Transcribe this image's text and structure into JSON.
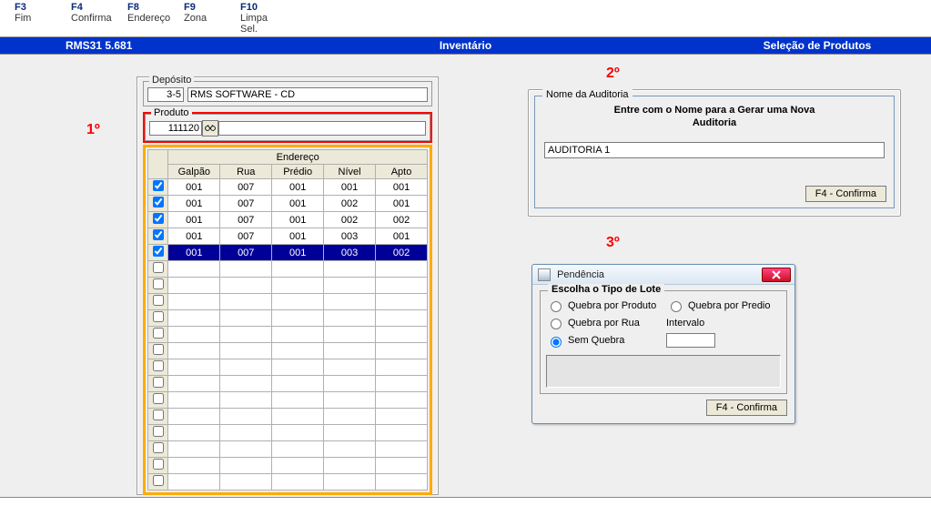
{
  "fkeys": [
    {
      "key": "F3",
      "label": "Fim"
    },
    {
      "key": "F4",
      "label": "Confirma"
    },
    {
      "key": "F8",
      "label": "Endereço"
    },
    {
      "key": "F9",
      "label": "Zona"
    },
    {
      "key": "F10",
      "label": "Limpa Sel."
    }
  ],
  "bluebar": {
    "left": "RMS31 5.681",
    "center": "Inventário",
    "right": "Seleção de Produtos"
  },
  "callouts": {
    "c1": "1º",
    "c2": "2º",
    "c3": "3º"
  },
  "deposito": {
    "title": "Depósito",
    "code": "3-5",
    "name": "RMS SOFTWARE - CD"
  },
  "produto": {
    "title": "Produto",
    "code": "111120",
    "name": ""
  },
  "endereco": {
    "title": "Endereço",
    "cols": [
      "Galpão",
      "Rua",
      "Prédio",
      "Nível",
      "Apto"
    ],
    "rows": [
      {
        "chk": true,
        "cells": [
          "001",
          "007",
          "001",
          "001",
          "001"
        ],
        "selected": false
      },
      {
        "chk": true,
        "cells": [
          "001",
          "007",
          "001",
          "002",
          "001"
        ],
        "selected": false
      },
      {
        "chk": true,
        "cells": [
          "001",
          "007",
          "001",
          "002",
          "002"
        ],
        "selected": false
      },
      {
        "chk": true,
        "cells": [
          "001",
          "007",
          "001",
          "003",
          "001"
        ],
        "selected": false
      },
      {
        "chk": true,
        "cells": [
          "001",
          "007",
          "001",
          "003",
          "002"
        ],
        "selected": true
      }
    ],
    "empty_rows": 14
  },
  "audit": {
    "group_title": "Nome da Auditoria",
    "instr_line1": "Entre com o Nome para a Gerar uma Nova",
    "instr_line2": "Auditoria",
    "value": "AUDITORIA 1",
    "confirm": "F4 - Confirma"
  },
  "pend": {
    "title": "Pendência",
    "group_title": "Escolha o Tipo de Lote",
    "radios": {
      "produto": "Quebra por Produto",
      "predio": "Quebra por Predio",
      "rua": "Quebra por Rua",
      "sem": "Sem Quebra"
    },
    "interval_label": "Intervalo",
    "interval_value": "",
    "confirm": "F4 - Confirma"
  }
}
